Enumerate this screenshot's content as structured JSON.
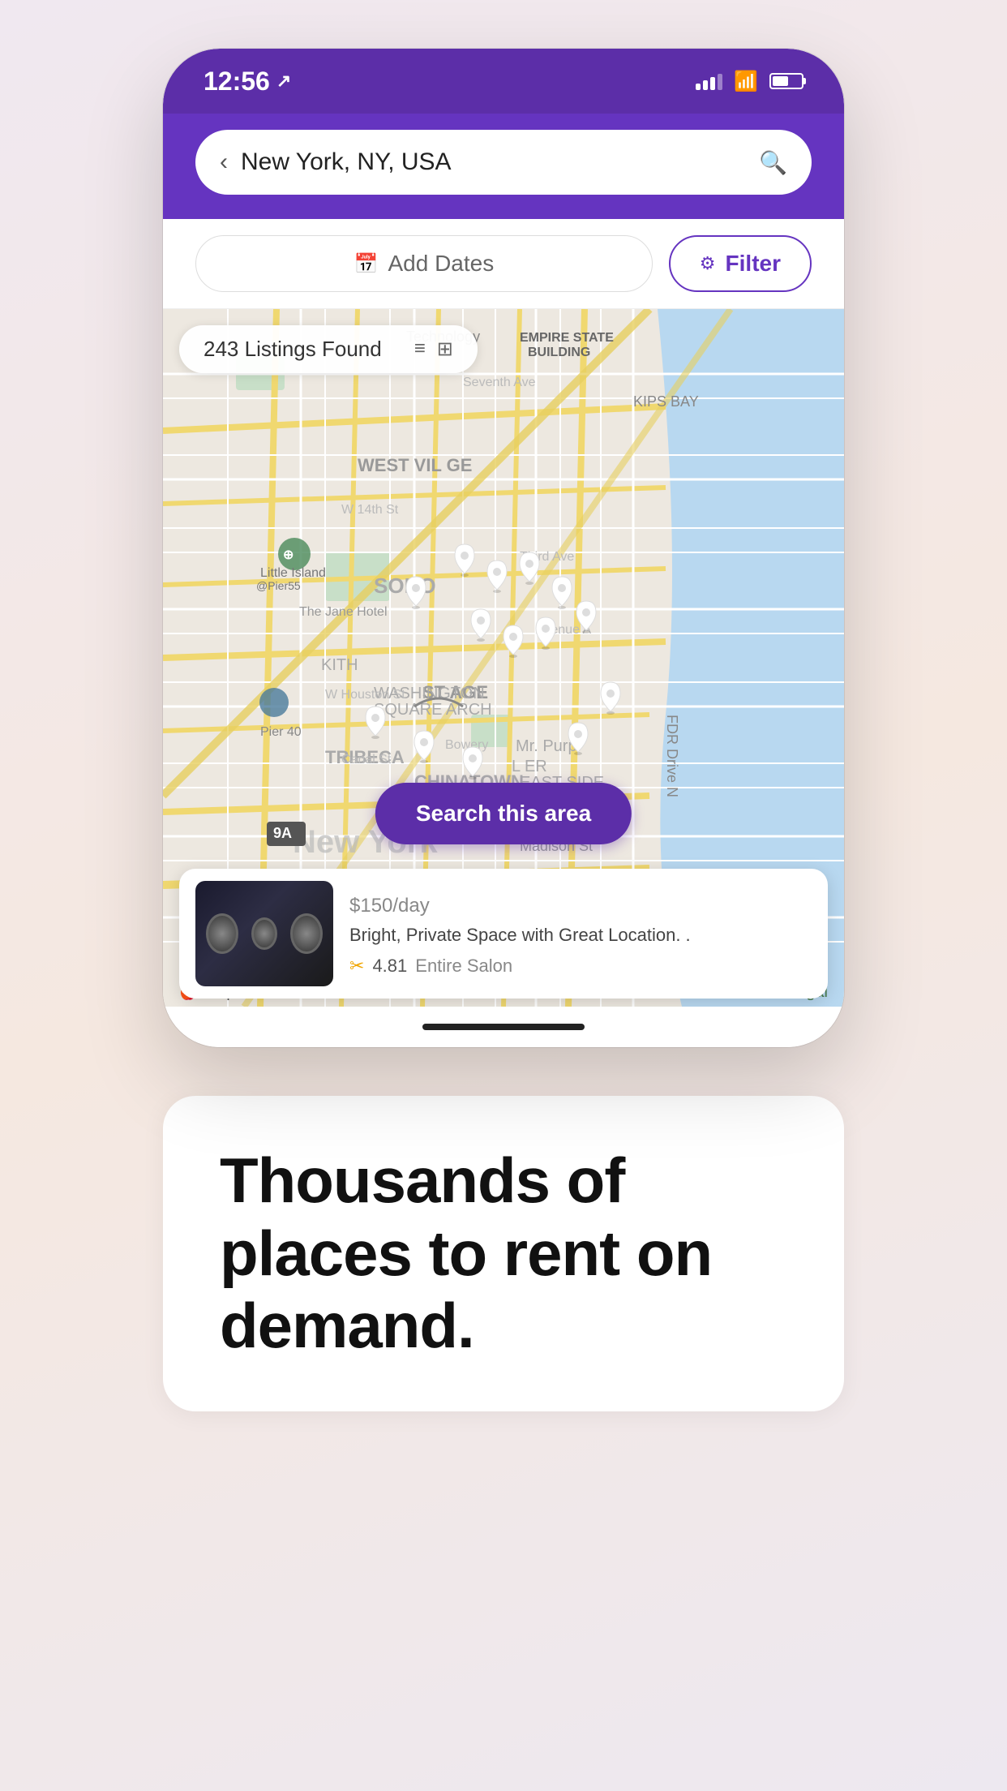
{
  "statusBar": {
    "time": "12:56",
    "locationArrow": "↗"
  },
  "searchBar": {
    "backLabel": "‹",
    "query": "New York, NY, USA",
    "searchIconLabel": "🔍"
  },
  "filterRow": {
    "addDatesLabel": "Add Dates",
    "filterLabel": "Filter"
  },
  "map": {
    "listingsCount": "243 Listings Found",
    "searchAreaButton": "Search this area"
  },
  "listingCard": {
    "price": "$150",
    "priceUnit": "/day",
    "title": "Bright, Private Space with Great Location. .",
    "rating": "4.81",
    "type": "Entire Salon"
  },
  "mapAttribution": {
    "mapsLabel": "Maps",
    "legalLabel": "Legal"
  },
  "bottomSection": {
    "headline": "Thousands of places to rent on demand."
  }
}
